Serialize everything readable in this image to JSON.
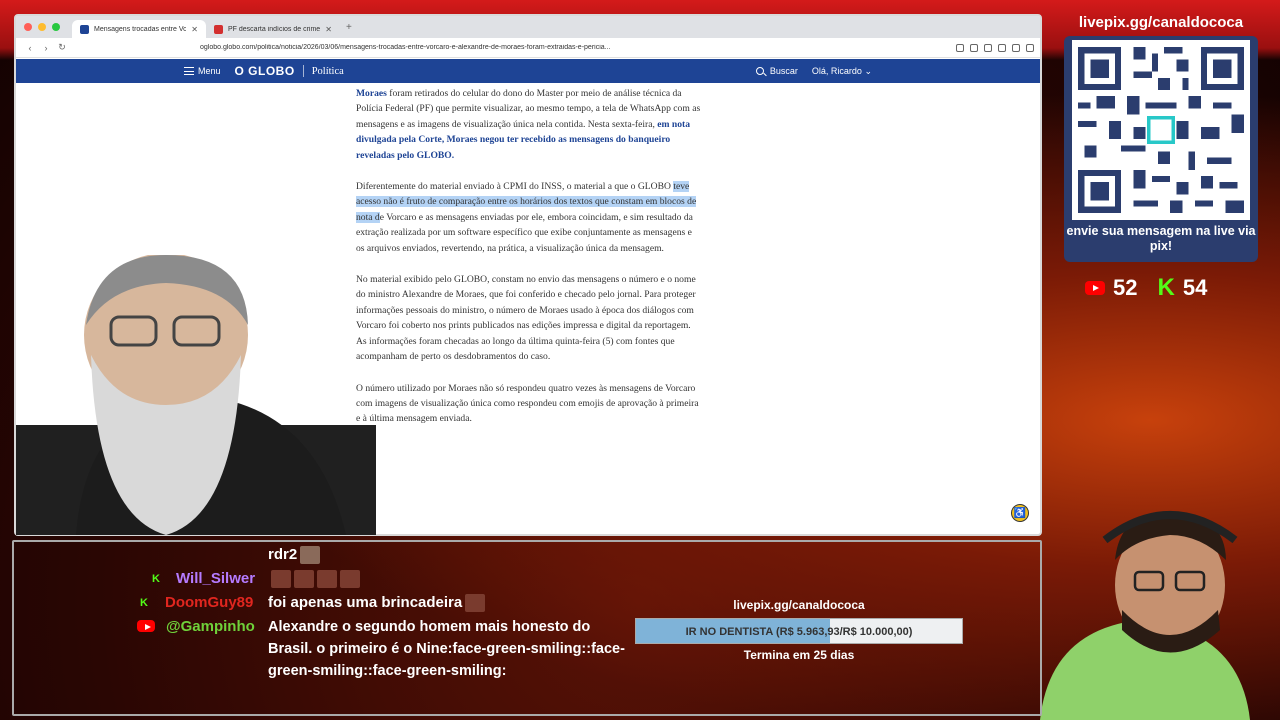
{
  "browser": {
    "tabs": [
      {
        "title": "Mensagens trocadas entre Vo",
        "active": true,
        "favicon_color": "#1e4495"
      },
      {
        "title": "PF descarta indícios de crime em",
        "active": false,
        "favicon_color": "#d32f2f"
      }
    ],
    "url": "oglobo.globo.com/politica/noticia/2026/03/06/mensagens-trocadas-entre-vorcaro-e-alexandre-de-moraes-foram-extraidas-e-pericia..."
  },
  "site": {
    "menu_label": "Menu",
    "logo": "O GLOBO",
    "section": "Política",
    "search_label": "Buscar",
    "user_label": "Olá, Ricardo"
  },
  "article": {
    "p1_blue_start": "Moraes",
    "p1_text": " foram retirados do celular do dono do Master por meio de análise técnica da Polícia Federal (PF) que permite visualizar, ao mesmo tempo, a tela de WhatsApp com as mensagens e as imagens de visualização única nela contida.  Nesta sexta-feira, ",
    "p1_blue_end": "em nota divulgada pela Corte, Moraes negou ter recebido as mensagens do banqueiro reveladas pelo GLOBO.",
    "p2_before": "Diferentemente do material enviado à CPMI do INSS, o material a que o GLOBO ",
    "p2_highlight": "teve acesso não é fruto de comparação entre os horários dos textos que constam em blocos de nota d",
    "p2_after": "e Vorcaro e as mensagens enviadas por ele, embora coincidam, e sim resultado da extração realizada por um software específico que exibe conjuntamente as mensagens e os arquivos enviados, revertendo, na prática, a visualização única da mensagem.",
    "p3": "No material exibido pelo GLOBO, constam no envio das mensagens o número e o nome do ministro Alexandre de Moraes, que foi conferido e checado pelo jornal. Para proteger informações pessoais do ministro, o número de Moraes usado à época dos diálogos com Vorcaro foi coberto nos prints publicados nas edições impressa e digital da reportagem. As informações foram checadas ao longo da última quinta-feira (5) com fontes que acompanham de perto os desdobramentos do caso.",
    "p4": "O número utilizado por Moraes não só respondeu quatro vezes às mensagens de Vorcaro com imagens de visualização única como respondeu com emojis de aprovação à primeira e à última mensagem enviada."
  },
  "panel": {
    "pix_url": "livepix.gg/canaldococa",
    "qr_caption": "envie sua mensagem na live via pix!",
    "youtube_count": "52",
    "kick_count": "54",
    "youtube_color": "#ff0000",
    "kick_color": "#53fc18"
  },
  "chat": {
    "messages": [
      {
        "user": "",
        "text": "rdr2",
        "user_color": "#ffffff"
      },
      {
        "user": "Will_Silwer",
        "text": "",
        "user_color": "#b57bff",
        "platform": "kick"
      },
      {
        "user": "DoomGuy89",
        "text": "foi apenas uma brincadeira",
        "user_color": "#e0261f",
        "platform": "kick"
      },
      {
        "user": "@Gampinho",
        "text": "Alexandre o segundo homem mais honesto do Brasil. o primeiro é o Nine:face-green-smiling::face-green-smiling::face-green-smiling:",
        "user_color": "#6fd13a",
        "platform": "youtube"
      }
    ]
  },
  "goal": {
    "site": "livepix.gg/canaldococa",
    "label": "IR NO DENTISTA (R$ 5.963,93/R$ 10.000,00)",
    "progress": 0.5964,
    "ends": "Termina em 25 dias"
  }
}
